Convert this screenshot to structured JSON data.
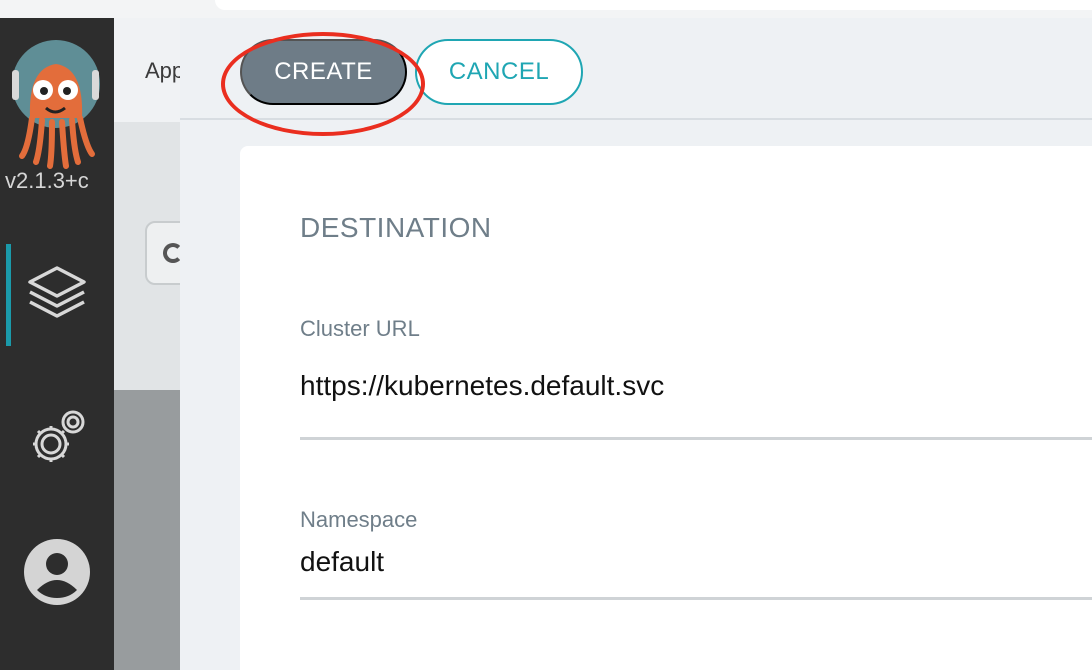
{
  "sidebar": {
    "version": "v2.1.3+c",
    "nav": [
      {
        "icon": "layers-icon",
        "active": true
      },
      {
        "icon": "gears-icon",
        "active": false
      },
      {
        "icon": "user-avatar-icon",
        "active": false
      }
    ],
    "accent_color": "#1b9aaa"
  },
  "background_page": {
    "title": "App"
  },
  "toolbar": {
    "create_label": "CREATE",
    "cancel_label": "CANCEL"
  },
  "form": {
    "section_title": "DESTINATION",
    "cluster_url": {
      "label": "Cluster URL",
      "value": "https://kubernetes.default.svc"
    },
    "namespace": {
      "label": "Namespace",
      "value": "default"
    }
  },
  "colors": {
    "create_button": "#6e7c87",
    "cancel_accent": "#1fa6b3",
    "highlight_ring": "#ea2e1f"
  }
}
